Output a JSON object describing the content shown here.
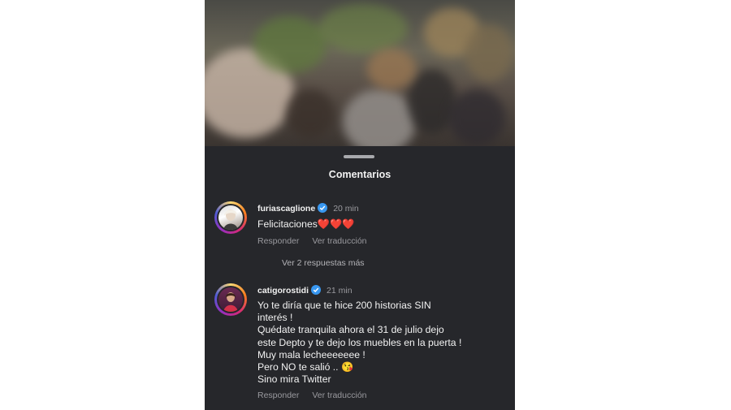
{
  "sheet": {
    "title": "Comentarios"
  },
  "comments": [
    {
      "username": "furiascaglione",
      "time": "20 min",
      "text": "Felicitaciones",
      "emoji": "❤️❤️❤️",
      "reply_label": "Responder",
      "translate_label": "Ver traducción",
      "more_replies": "Ver 2 respuestas más"
    },
    {
      "username": "catigorostidi",
      "time": "21 min",
      "lines": [
        "Yo te diría que te hice 200 historias SIN",
        "interés !",
        "Quédate tranquila ahora el 31 de julio dejo",
        "este Depto y te dejo los muebles en la puerta !",
        "Muy mala lecheeeeeee !",
        "Pero NO te salió .. 😘",
        "Sino mira Twitter"
      ],
      "reply_label": "Responder",
      "translate_label": "Ver traducción"
    }
  ],
  "colors": {
    "sheet_bg": "#26272b",
    "verified": "#3897f0",
    "muted_text": "#9a9a9f"
  }
}
